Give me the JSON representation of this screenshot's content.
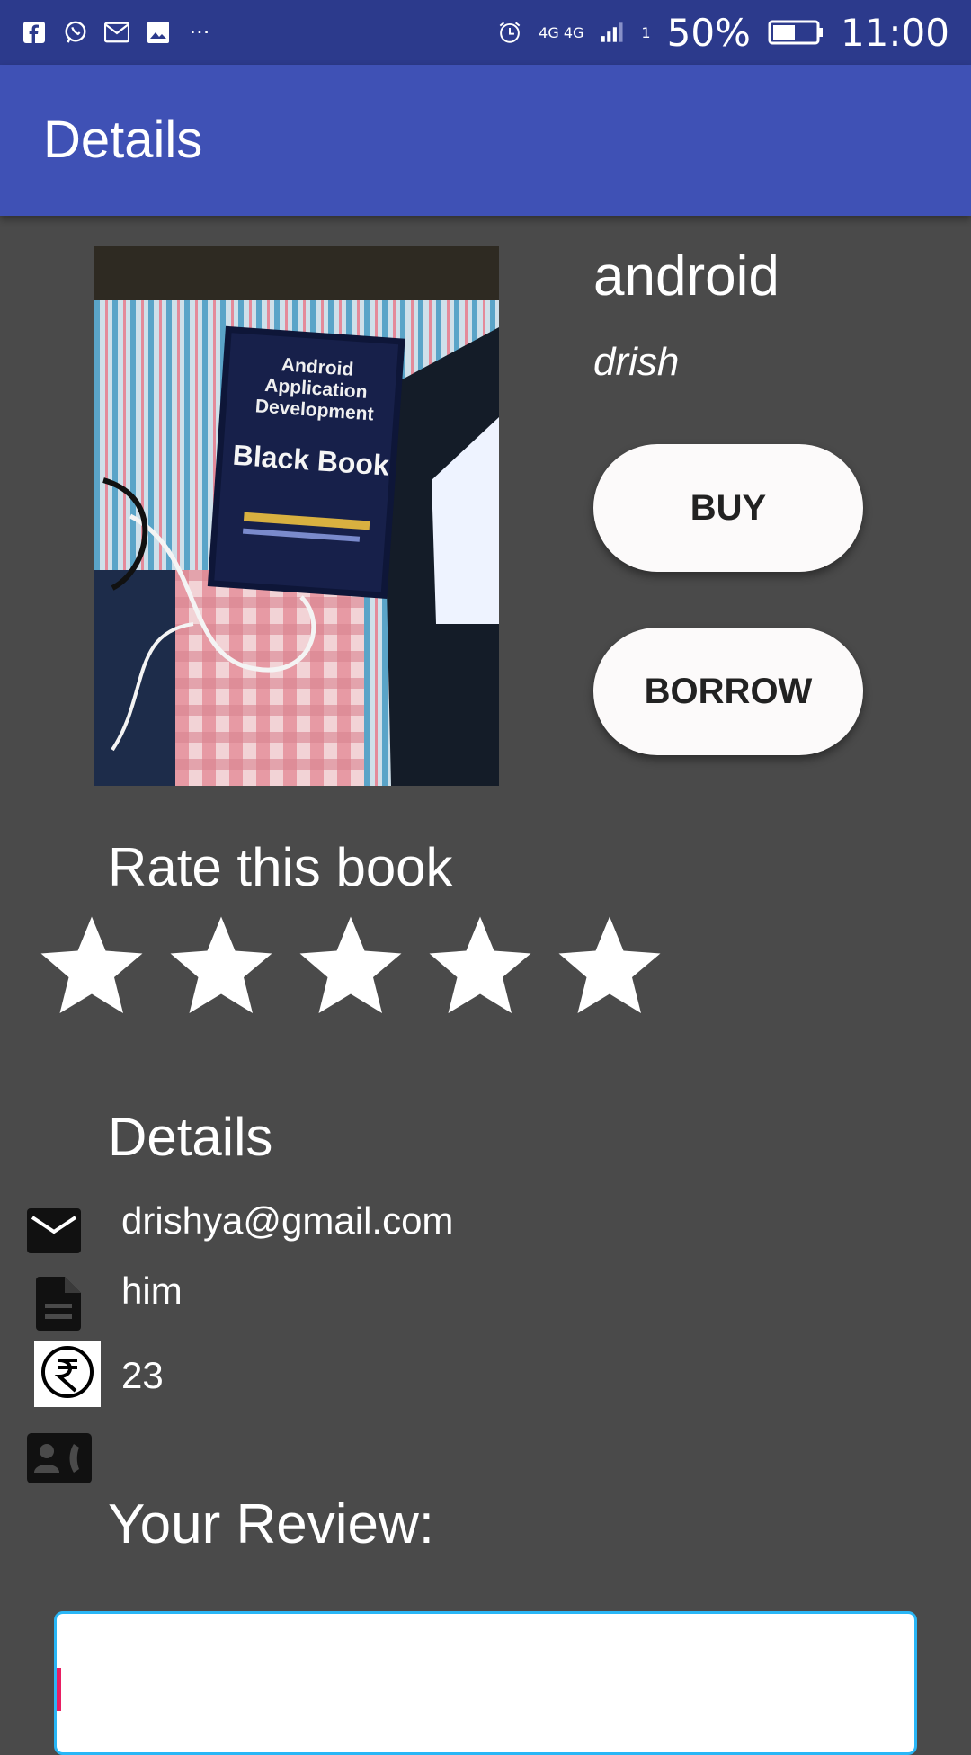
{
  "status_bar": {
    "left_icons": [
      "facebook-icon",
      "whatsapp-icon",
      "gmail-icon",
      "image-icon",
      "more-notifications-icon"
    ],
    "more_glyph": "···",
    "network_label": "4G 4G",
    "sim_label": "1",
    "battery": "50%",
    "time": "11:00"
  },
  "app_bar": {
    "title": "Details"
  },
  "book": {
    "title": "android",
    "author": "drish",
    "cover_text": [
      "Android",
      "Application",
      "Development",
      "Black Book"
    ]
  },
  "actions": {
    "buy_label": "BUY",
    "borrow_label": "BORROW"
  },
  "rating": {
    "label": "Rate this book",
    "max": 5,
    "value": 5
  },
  "details": {
    "label": "Details",
    "email": "drishya@gmail.com",
    "description": "him",
    "price": "23",
    "contact": ""
  },
  "review": {
    "label": "Your Review:",
    "value": ""
  },
  "colors": {
    "status_bar": "#2c3a8c",
    "app_bar": "#3f51b5",
    "background": "#4a4a4a",
    "review_border": "#29b6f6",
    "cursor": "#e91e63"
  }
}
